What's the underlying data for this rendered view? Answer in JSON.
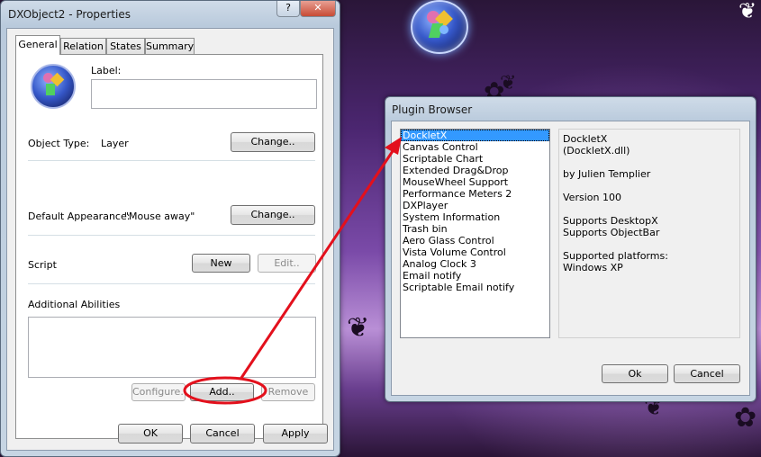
{
  "colors": {
    "annotation_red": "#e3101c",
    "selection_blue": "#3399ff"
  },
  "properties_window": {
    "title": "DXObject2 - Properties",
    "title_buttons": {
      "help": "?",
      "close": "✕"
    },
    "tabs": [
      "General",
      "Relation",
      "States",
      "Summary"
    ],
    "label_caption": "Label:",
    "label_value": "",
    "object_type_caption": "Object Type:",
    "object_type_value": "Layer",
    "change_label": "Change..",
    "default_appearance_caption": "Default Appearance:",
    "default_appearance_value": "\"Mouse away\"",
    "change2_label": "Change..",
    "script_caption": "Script",
    "new_label": "New",
    "edit_label": "Edit..",
    "additional_abilities_caption": "Additional Abilities",
    "configure_label": "Configure..",
    "add_label": "Add..",
    "remove_label": "Remove",
    "ok_label": "OK",
    "cancel_label": "Cancel",
    "apply_label": "Apply"
  },
  "plugin_browser": {
    "title": "Plugin Browser",
    "plugins": [
      "DockletX",
      "Canvas Control",
      "Scriptable Chart",
      "Extended Drag&Drop",
      "MouseWheel Support",
      "Performance Meters 2",
      "DXPlayer",
      "System Information",
      "Trash bin",
      "Aero Glass Control",
      "Vista Volume Control",
      "Analog Clock 3",
      "Email notify",
      "Scriptable Email notify"
    ],
    "selected_index": 0,
    "info": {
      "name": "DockletX",
      "file": "(DockletX.dll)",
      "author": "by Julien Templier",
      "version": "Version 100",
      "supports1": "Supports DesktopX",
      "supports2": "Supports ObjectBar",
      "platforms_caption": "Supported platforms:",
      "platforms": "Windows XP"
    },
    "ok_label": "Ok",
    "cancel_label": "Cancel"
  }
}
